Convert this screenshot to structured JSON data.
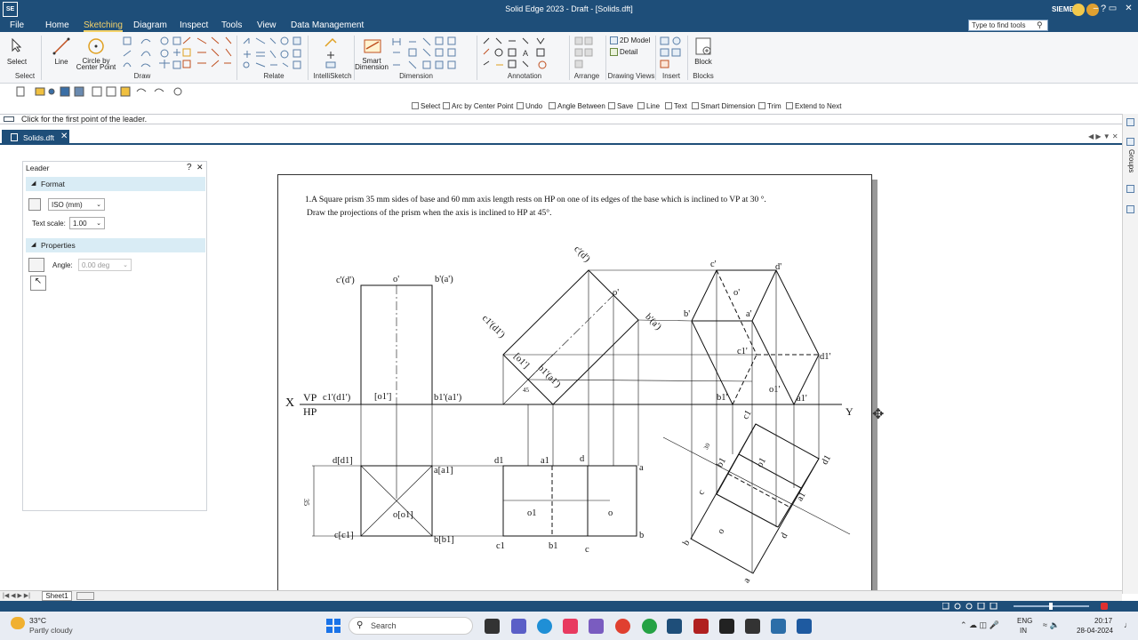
{
  "window": {
    "title": "Solid Edge 2023 - Draft - [Solids.dft]",
    "app_icon": "SE",
    "brand": "SIEMENS",
    "controls": [
      "–",
      "▭",
      "✕"
    ]
  },
  "menu": {
    "items": [
      "File",
      "Home",
      "Sketching",
      "Diagram",
      "Inspect",
      "Tools",
      "View",
      "Data Management"
    ],
    "active": "Sketching",
    "search_placeholder": "Type to find tools"
  },
  "ribbon": {
    "select_label": "Select",
    "line_label": "Line",
    "circle_label": "Circle by",
    "circle_label2": "Center Point",
    "smart_dim_label": "Smart",
    "smart_dim_label2": "Dimension",
    "model_2d": "2D Model",
    "detail": "Detail",
    "block_label": "Block",
    "groups": [
      "Select",
      "Draw",
      "Relate",
      "IntelliSketch",
      "Dimension",
      "Annotation",
      "Arrange",
      "Drawing Views",
      "Insert",
      "Blocks"
    ]
  },
  "commandbar": {
    "items": [
      "Select",
      "Arc by Center Point",
      "Undo",
      "Angle Between",
      "Save",
      "Line",
      "Text",
      "Smart Dimension",
      "Trim",
      "Extend to Next"
    ]
  },
  "prompt": "Click for the first point of the leader.",
  "document_tab": {
    "label": "Solids.dft",
    "close": "✕"
  },
  "right_strip": {
    "groups": "Groups"
  },
  "leader_panel": {
    "title": "Leader",
    "help": "?",
    "close": "✕",
    "format_header": "Format",
    "standard": "ISO (mm)",
    "text_scale_label": "Text scale:",
    "text_scale": "1.00",
    "properties_header": "Properties",
    "angle_label": "Angle:",
    "angle_value": "0.00 deg"
  },
  "drawing": {
    "problem_line1": "1.A Square prism 35 mm sides of base and 60 mm axis length rests on HP on one of its edges of the base which is inclined to VP at 30 °.",
    "problem_line2": "Draw the projections of the prism when the axis is inclined to HP at 45°.",
    "labels": {
      "x": "X",
      "y": "Y",
      "vp": "VP",
      "hp": "HP",
      "fv1_cd": "c'(d')",
      "fv1_o": "o'",
      "fv1_ba": "b'(a')",
      "fv1_c1d1": "c1'(d1')",
      "fv1_o1": "[o1']",
      "fv1_b1a1": "b1'(a1')",
      "tv1_dd1": "d[d1]",
      "tv1_aa1": "a[a1]",
      "tv1_oo1": "o[o1]",
      "tv1_cc1": "c[c1]",
      "tv1_bb1": "b[b1]",
      "dim35": "35",
      "tv2_d1": "d1",
      "tv2_a1": "a1",
      "tv2_d": "d",
      "tv2_a": "a",
      "tv2_o1": "o1",
      "tv2_o": "o",
      "tv2_c1": "c1",
      "tv2_b1": "b1",
      "tv2_c": "c",
      "tv2_b": "b",
      "fv2_cd": "c'(d')",
      "fv2_o": "o'",
      "fv2_ba": "b'(a')",
      "fv2_c1d1": "c1'(d1')",
      "fv2_o1": "[o1']",
      "fv2_b1a1": "b1'(a1')",
      "fv2_45": "45",
      "fv3_c": "c'",
      "fv3_d": "d'",
      "fv3_o": "o'",
      "fv3_b": "b'",
      "fv3_a": "a'",
      "fv3_c1": "c1'",
      "fv3_d1": "d1'",
      "fv3_o1": "o1'",
      "fv3_b1": "b1'",
      "fv3_a1": "a1'",
      "tv3_c1": "c1",
      "tv3_o1": "o1",
      "tv3_d1": "d1",
      "tv3_b1": "b1",
      "tv3_a1": "a1",
      "tv3_c": "c",
      "tv3_o": "o",
      "tv3_d": "d",
      "tv3_b": "b",
      "tv3_a": "a",
      "tv3_30": "30"
    }
  },
  "sheet_tab": "Sheet1",
  "taskbar": {
    "temp": "33°C",
    "weather": "Partly cloudy",
    "search": "Search",
    "lang1": "ENG",
    "lang2": "IN",
    "time": "20:17",
    "date": "28-04-2024"
  },
  "colors": {
    "title_blue": "#1e4e79",
    "ribbon_bg": "#f5f6f8",
    "panel_header": "#d9ecf5"
  }
}
